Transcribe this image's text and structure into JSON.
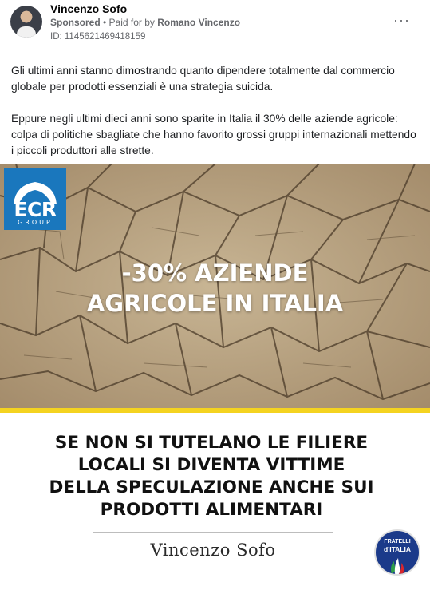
{
  "post": {
    "author": "Vincenzo Sofo",
    "sponsored_label": "Sponsored",
    "paid_prefix": " • Paid for by ",
    "payer": "Romano Vincenzo",
    "ad_id": "ID: 1145621469418159",
    "more_glyph": "···",
    "paragraphs": [
      "Gli ultimi anni stanno dimostrando quanto dipendere totalmente dal commercio globale per prodotti essenziali è una strategia suicida.",
      "Eppure negli ultimi dieci anni sono sparite in Italia il 30% delle aziende agricole: colpa di politiche sbagliate che hanno favorito grossi gruppi internazionali mettendo i piccoli produttori alle strette."
    ]
  },
  "creative": {
    "logo_text": "ECR",
    "logo_subtext": "GROUP",
    "headline_lines": [
      "-30% AZIENDE",
      "AGRICOLE IN ITALIA"
    ],
    "slogan_lines": [
      "SE NON SI TUTELANO LE FILIERE",
      "LOCALI SI DIVENTA VITTIME",
      "DELLA SPECULAZIONE ANCHE SUI",
      "PRODOTTI ALIMENTARI"
    ],
    "signature": "Vincenzo Sofo",
    "party_logo_top": "FRATELLI",
    "party_logo_bottom": "d'ITALIA"
  },
  "colors": {
    "ecr_blue": "#1a77bd",
    "accent_yellow": "#f4d320",
    "party_blue": "#1b3a8a"
  },
  "icons": {
    "avatar": "person-photo",
    "more": "ellipsis-icon",
    "ecr": "ecr-dome-logo",
    "party": "fratelli-ditalia-flame-logo"
  }
}
